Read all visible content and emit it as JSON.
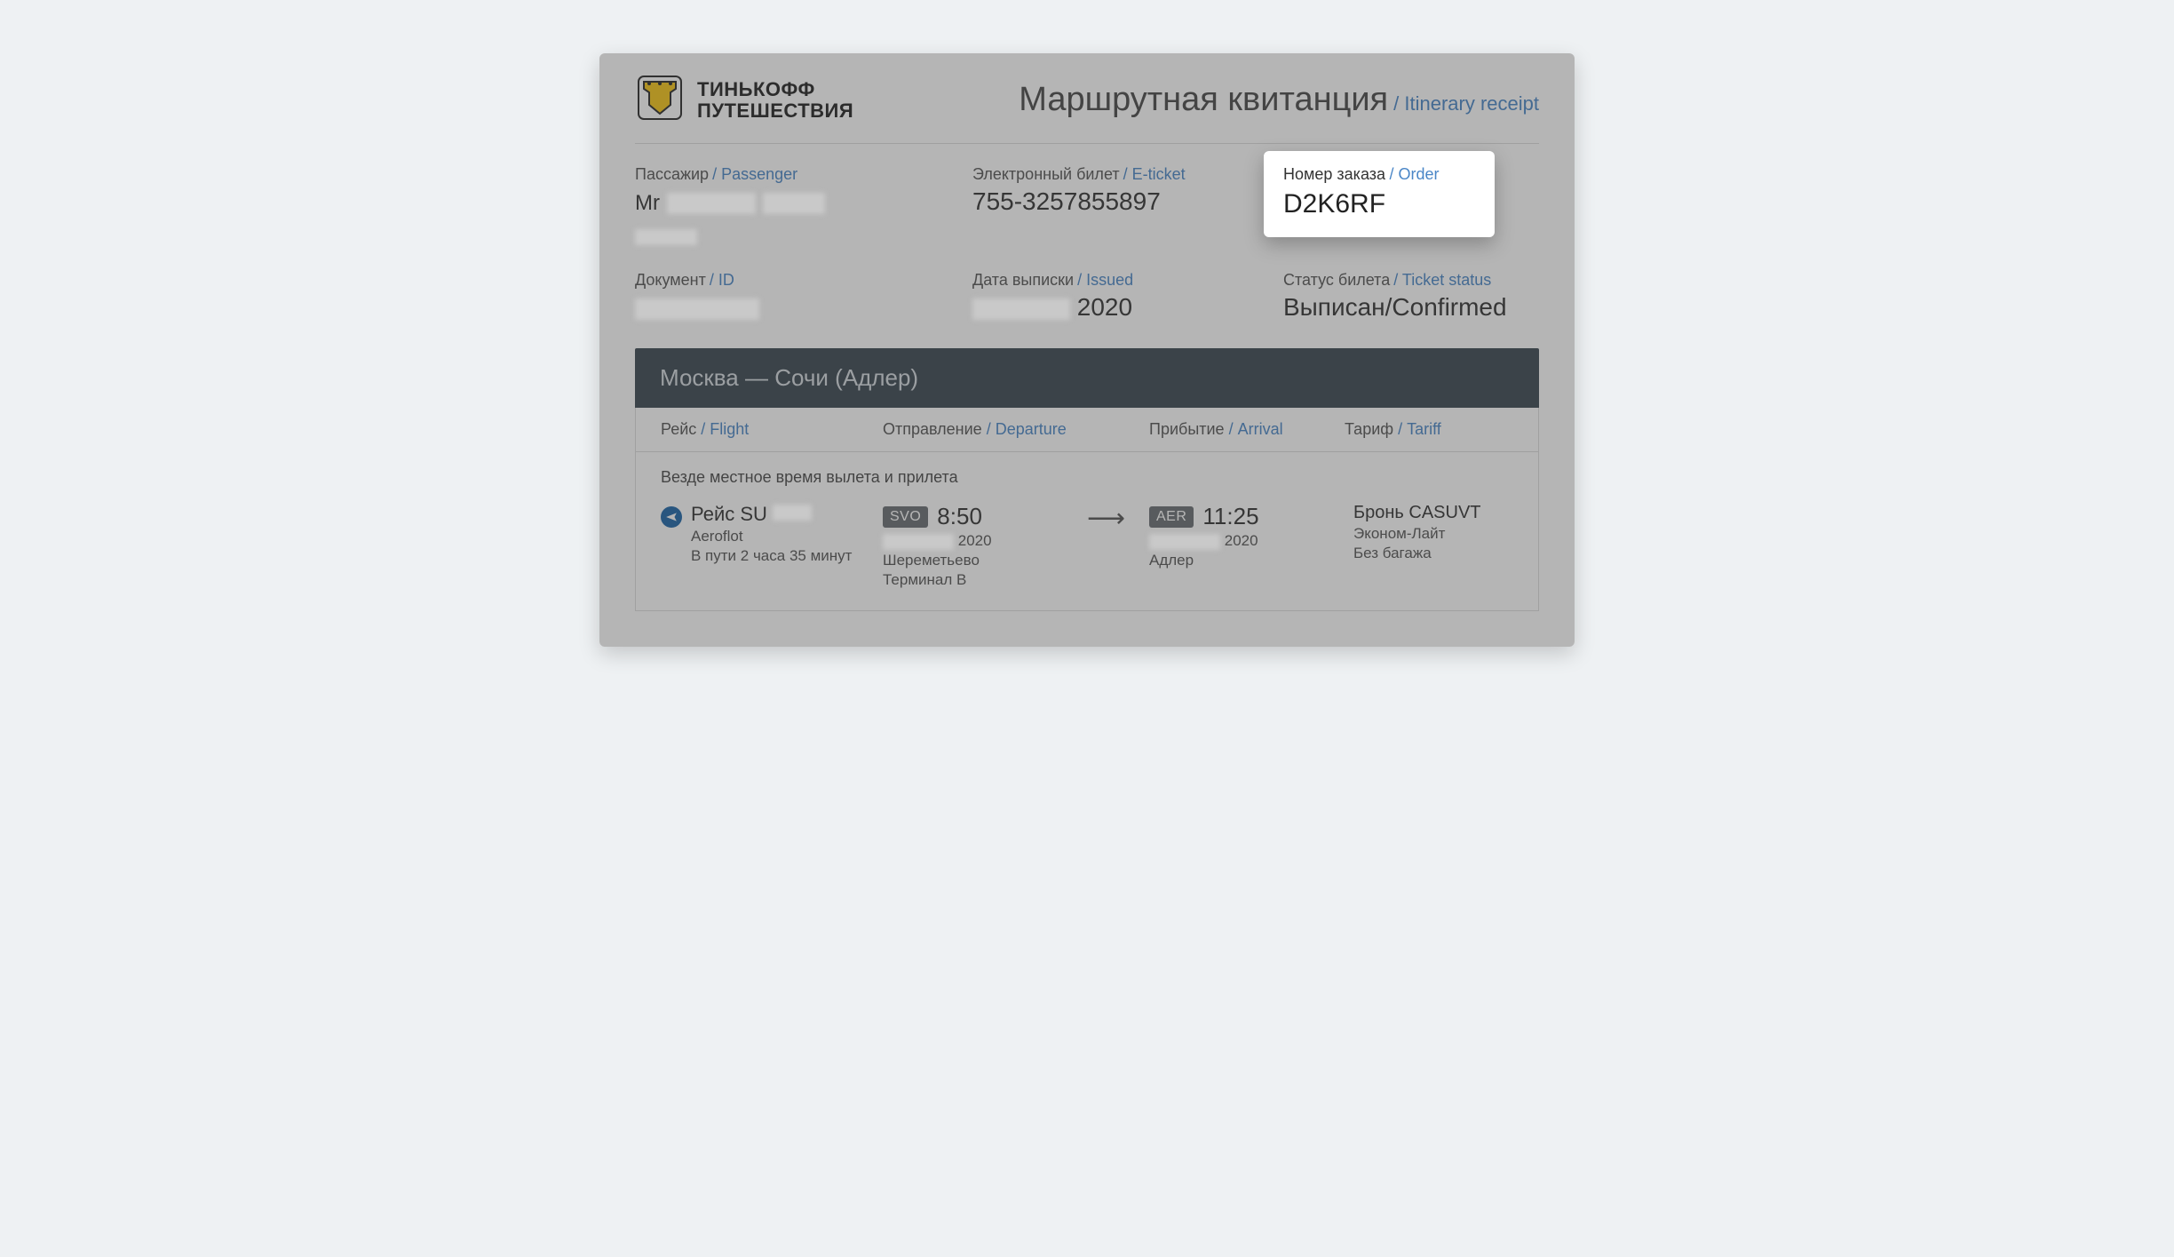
{
  "brand": {
    "line1": "ТИНЬКОФФ",
    "line2": "ПУТЕШЕСТВИЯ"
  },
  "title": {
    "ru": "Маршрутная квитанция",
    "en": "Itinerary receipt"
  },
  "labels": {
    "passenger": {
      "ru": "Пассажир",
      "en": "Passenger"
    },
    "eticket": {
      "ru": "Электронный билет",
      "en": "E-ticket"
    },
    "order": {
      "ru": "Номер заказа",
      "en": "Order"
    },
    "document": {
      "ru": "Документ",
      "en": "ID"
    },
    "issued": {
      "ru": "Дата выписки",
      "en": "Issued"
    },
    "status": {
      "ru": "Статус билета",
      "en": "Ticket status"
    },
    "flight": {
      "ru": "Рейс",
      "en": "Flight"
    },
    "departure": {
      "ru": "Отправление",
      "en": "Departure"
    },
    "arrival": {
      "ru": "Прибытие",
      "en": "Arrival"
    },
    "tariff": {
      "ru": "Тариф",
      "en": "Tariff"
    }
  },
  "passenger": {
    "prefix": "Mr"
  },
  "eticket": "755-3257855897",
  "order": "D2K6RF",
  "issued_year": "2020",
  "status": "Выписан/Confirmed",
  "route_title": "Москва — Сочи (Адлер)",
  "localtime_note": "Везде местное время вылета и прилета",
  "flight": {
    "prefix": "Рейс SU",
    "airline": "Aeroflot",
    "duration": "В пути 2 часа 35 минут",
    "departure": {
      "code": "SVO",
      "time": "8:50",
      "year": "2020",
      "airport": "Шереметьево",
      "terminal": "Терминал B"
    },
    "arrival": {
      "code": "AER",
      "time": "11:25",
      "year": "2020",
      "airport": "Адлер"
    },
    "tariff": {
      "booking": "Бронь CASUVT",
      "class": "Эконом-Лайт",
      "baggage": "Без багажа"
    }
  }
}
